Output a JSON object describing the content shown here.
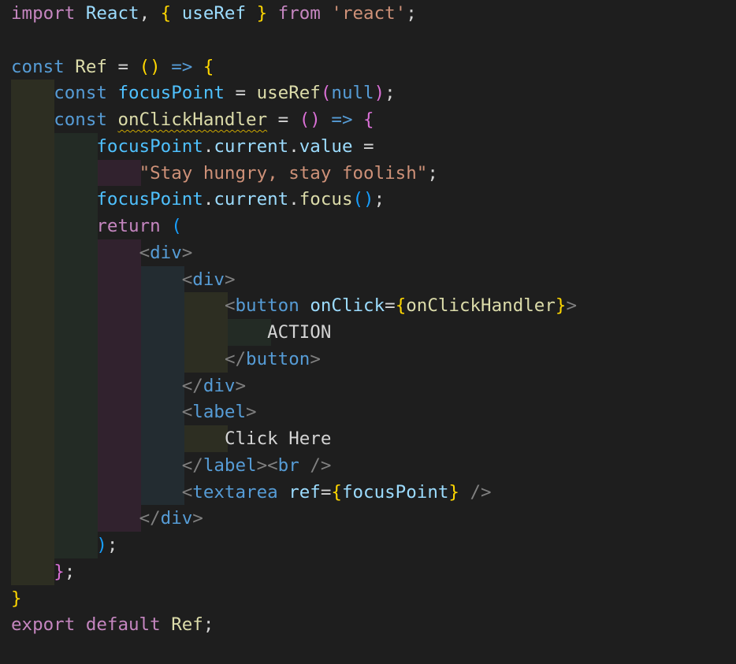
{
  "editor": {
    "language": "javascript-react",
    "colors": {
      "background": "#1e1e1e",
      "keyword": "#c586c0",
      "storage": "#569cd6",
      "variable": "#9cdcfe",
      "constant": "#4fc1ff",
      "function": "#dcdcaa",
      "string": "#ce9178",
      "bracket_gold": "#ffd700",
      "bracket_pink": "#da70d6",
      "bracket_blue": "#179fff",
      "jsx_tag": "#569cd6",
      "jsx_angle": "#808080",
      "jsx_attr": "#9cdcfe",
      "jsx_text": "#d4d4d4",
      "warning_squiggle": "#cca700"
    },
    "lines": [
      [
        {
          "t": "import",
          "c": "#c586c0"
        },
        {
          "t": " "
        },
        {
          "t": "React",
          "c": "#9cdcfe"
        },
        {
          "t": ", "
        },
        {
          "t": "{",
          "c": "#ffd700"
        },
        {
          "t": " "
        },
        {
          "t": "useRef",
          "c": "#9cdcfe"
        },
        {
          "t": " "
        },
        {
          "t": "}",
          "c": "#ffd700"
        },
        {
          "t": " "
        },
        {
          "t": "from",
          "c": "#c586c0"
        },
        {
          "t": " "
        },
        {
          "t": "'react'",
          "c": "#ce9178"
        },
        {
          "t": ";"
        }
      ],
      [],
      [
        {
          "t": "const",
          "c": "#569cd6"
        },
        {
          "t": " "
        },
        {
          "t": "Ref",
          "c": "#dcdcaa"
        },
        {
          "t": " = "
        },
        {
          "t": "()",
          "c": "#ffd700"
        },
        {
          "t": " "
        },
        {
          "t": "=>",
          "c": "#569cd6"
        },
        {
          "t": " "
        },
        {
          "t": "{",
          "c": "#ffd700"
        }
      ],
      [
        {
          "t": "    "
        },
        {
          "t": "const",
          "c": "#569cd6"
        },
        {
          "t": " "
        },
        {
          "t": "focusPoint",
          "c": "#4fc1ff"
        },
        {
          "t": " = "
        },
        {
          "t": "useRef",
          "c": "#dcdcaa"
        },
        {
          "t": "(",
          "c": "#da70d6"
        },
        {
          "t": "null",
          "c": "#569cd6"
        },
        {
          "t": ")",
          "c": "#da70d6"
        },
        {
          "t": ";"
        }
      ],
      [
        {
          "t": "    "
        },
        {
          "t": "const",
          "c": "#569cd6"
        },
        {
          "t": " "
        },
        {
          "t": "onClickHandler",
          "c": "#dcdcaa",
          "sq": true
        },
        {
          "t": " = "
        },
        {
          "t": "()",
          "c": "#da70d6"
        },
        {
          "t": " "
        },
        {
          "t": "=>",
          "c": "#569cd6"
        },
        {
          "t": " "
        },
        {
          "t": "{",
          "c": "#da70d6"
        }
      ],
      [
        {
          "t": "        "
        },
        {
          "t": "focusPoint",
          "c": "#4fc1ff"
        },
        {
          "t": "."
        },
        {
          "t": "current",
          "c": "#9cdcfe"
        },
        {
          "t": "."
        },
        {
          "t": "value",
          "c": "#9cdcfe"
        },
        {
          "t": " ="
        }
      ],
      [
        {
          "t": "            "
        },
        {
          "t": "\"Stay hungry, stay foolish\"",
          "c": "#ce9178"
        },
        {
          "t": ";"
        }
      ],
      [
        {
          "t": "        "
        },
        {
          "t": "focusPoint",
          "c": "#4fc1ff"
        },
        {
          "t": "."
        },
        {
          "t": "current",
          "c": "#9cdcfe"
        },
        {
          "t": "."
        },
        {
          "t": "focus",
          "c": "#dcdcaa"
        },
        {
          "t": "()",
          "c": "#179fff"
        },
        {
          "t": ";"
        }
      ],
      [
        {
          "t": "        "
        },
        {
          "t": "return",
          "c": "#c586c0"
        },
        {
          "t": " "
        },
        {
          "t": "(",
          "c": "#179fff"
        }
      ],
      [
        {
          "t": "            "
        },
        {
          "t": "<",
          "c": "#808080"
        },
        {
          "t": "div",
          "c": "#569cd6"
        },
        {
          "t": ">",
          "c": "#808080"
        }
      ],
      [
        {
          "t": "                "
        },
        {
          "t": "<",
          "c": "#808080"
        },
        {
          "t": "div",
          "c": "#569cd6"
        },
        {
          "t": ">",
          "c": "#808080"
        }
      ],
      [
        {
          "t": "                    "
        },
        {
          "t": "<",
          "c": "#808080"
        },
        {
          "t": "button",
          "c": "#569cd6"
        },
        {
          "t": " "
        },
        {
          "t": "onClick",
          "c": "#9cdcfe"
        },
        {
          "t": "="
        },
        {
          "t": "{",
          "c": "#ffd700"
        },
        {
          "t": "onClickHandler",
          "c": "#dcdcaa"
        },
        {
          "t": "}",
          "c": "#ffd700"
        },
        {
          "t": ">",
          "c": "#808080"
        }
      ],
      [
        {
          "t": "                        "
        },
        {
          "t": "ACTION"
        }
      ],
      [
        {
          "t": "                    "
        },
        {
          "t": "</",
          "c": "#808080"
        },
        {
          "t": "button",
          "c": "#569cd6"
        },
        {
          "t": ">",
          "c": "#808080"
        }
      ],
      [
        {
          "t": "                "
        },
        {
          "t": "</",
          "c": "#808080"
        },
        {
          "t": "div",
          "c": "#569cd6"
        },
        {
          "t": ">",
          "c": "#808080"
        }
      ],
      [
        {
          "t": "                "
        },
        {
          "t": "<",
          "c": "#808080"
        },
        {
          "t": "label",
          "c": "#569cd6"
        },
        {
          "t": ">",
          "c": "#808080"
        }
      ],
      [
        {
          "t": "                    "
        },
        {
          "t": "Click Here"
        }
      ],
      [
        {
          "t": "                "
        },
        {
          "t": "</",
          "c": "#808080"
        },
        {
          "t": "label",
          "c": "#569cd6"
        },
        {
          "t": ">",
          "c": "#808080"
        },
        {
          "t": "<",
          "c": "#808080"
        },
        {
          "t": "br",
          "c": "#569cd6"
        },
        {
          "t": " "
        },
        {
          "t": "/>",
          "c": "#808080"
        }
      ],
      [
        {
          "t": "                "
        },
        {
          "t": "<",
          "c": "#808080"
        },
        {
          "t": "textarea",
          "c": "#569cd6"
        },
        {
          "t": " "
        },
        {
          "t": "ref",
          "c": "#9cdcfe"
        },
        {
          "t": "="
        },
        {
          "t": "{",
          "c": "#ffd700"
        },
        {
          "t": "focusPoint",
          "c": "#9cdcfe"
        },
        {
          "t": "}",
          "c": "#ffd700"
        },
        {
          "t": " "
        },
        {
          "t": "/>",
          "c": "#808080"
        }
      ],
      [
        {
          "t": "            "
        },
        {
          "t": "</",
          "c": "#808080"
        },
        {
          "t": "div",
          "c": "#569cd6"
        },
        {
          "t": ">",
          "c": "#808080"
        }
      ],
      [
        {
          "t": "        "
        },
        {
          "t": ")",
          "c": "#179fff"
        },
        {
          "t": ";"
        }
      ],
      [
        {
          "t": "    "
        },
        {
          "t": "}",
          "c": "#da70d6"
        },
        {
          "t": ";"
        }
      ],
      [
        {
          "t": "}",
          "c": "#ffd700"
        }
      ],
      [
        {
          "t": "export",
          "c": "#c586c0"
        },
        {
          "t": " "
        },
        {
          "t": "default",
          "c": "#c586c0"
        },
        {
          "t": " "
        },
        {
          "t": "Ref",
          "c": "#dcdcaa"
        },
        {
          "t": ";"
        }
      ]
    ],
    "indent_bands": [
      {
        "level": 1,
        "color": "#2d2e22",
        "from_line": 3,
        "to_line": 21
      },
      {
        "level": 2,
        "color": "#232b25",
        "from_line": 5,
        "to_line": 20
      },
      {
        "level": 3,
        "color": "#31222e",
        "from_line": 6,
        "to_line": 6
      },
      {
        "level": 3,
        "color": "#31222e",
        "from_line": 9,
        "to_line": 19
      },
      {
        "level": 4,
        "color": "#232c31",
        "from_line": 10,
        "to_line": 18
      },
      {
        "level": 5,
        "color": "#2d2e22",
        "from_line": 11,
        "to_line": 13
      },
      {
        "level": 5,
        "color": "#2d2e22",
        "from_line": 16,
        "to_line": 16
      },
      {
        "level": 6,
        "color": "#232b25",
        "from_line": 12,
        "to_line": 12
      }
    ]
  }
}
